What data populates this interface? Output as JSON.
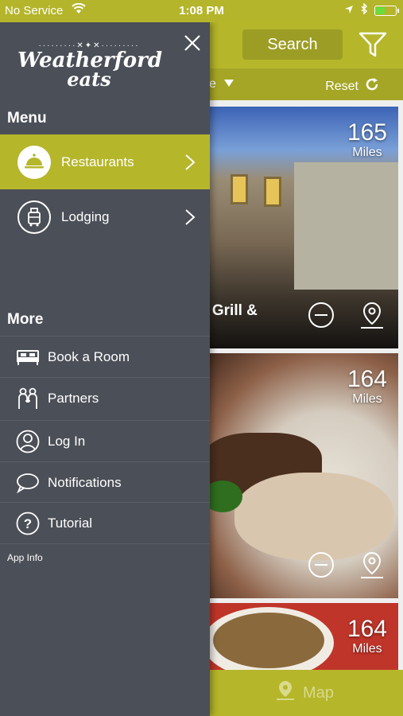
{
  "status_bar": {
    "carrier": "No Service",
    "time": "1:08 PM",
    "battery_level": 0.45
  },
  "header": {
    "search_label": "Search",
    "sort_label_partial": "ce",
    "reset_label": "Reset"
  },
  "listings": [
    {
      "distance": "165",
      "unit": "Miles",
      "title_partial": "n Grill &"
    },
    {
      "distance": "164",
      "unit": "Miles",
      "title_partial": ""
    },
    {
      "distance": "164",
      "unit": "Miles",
      "title_partial": ""
    }
  ],
  "map_bar": {
    "label": "Map"
  },
  "drawer": {
    "logo": {
      "line1": "Weatherford",
      "line2": "eats"
    },
    "menu_heading": "Menu",
    "menu_items": [
      {
        "label": "Restaurants",
        "icon": "cloche-icon",
        "active": true
      },
      {
        "label": "Lodging",
        "icon": "luggage-icon",
        "active": false
      }
    ],
    "more_heading": "More",
    "more_items": [
      {
        "label": "Book a Room",
        "icon": "bed-icon"
      },
      {
        "label": "Partners",
        "icon": "partners-icon"
      },
      {
        "label": "Log In",
        "icon": "user-icon"
      },
      {
        "label": "Notifications",
        "icon": "chat-bubble-icon"
      },
      {
        "label": "Tutorial",
        "icon": "help-icon"
      }
    ],
    "app_info": "App Info"
  },
  "colors": {
    "accent": "#b5b62a",
    "drawer_bg": "#4b4f57"
  }
}
